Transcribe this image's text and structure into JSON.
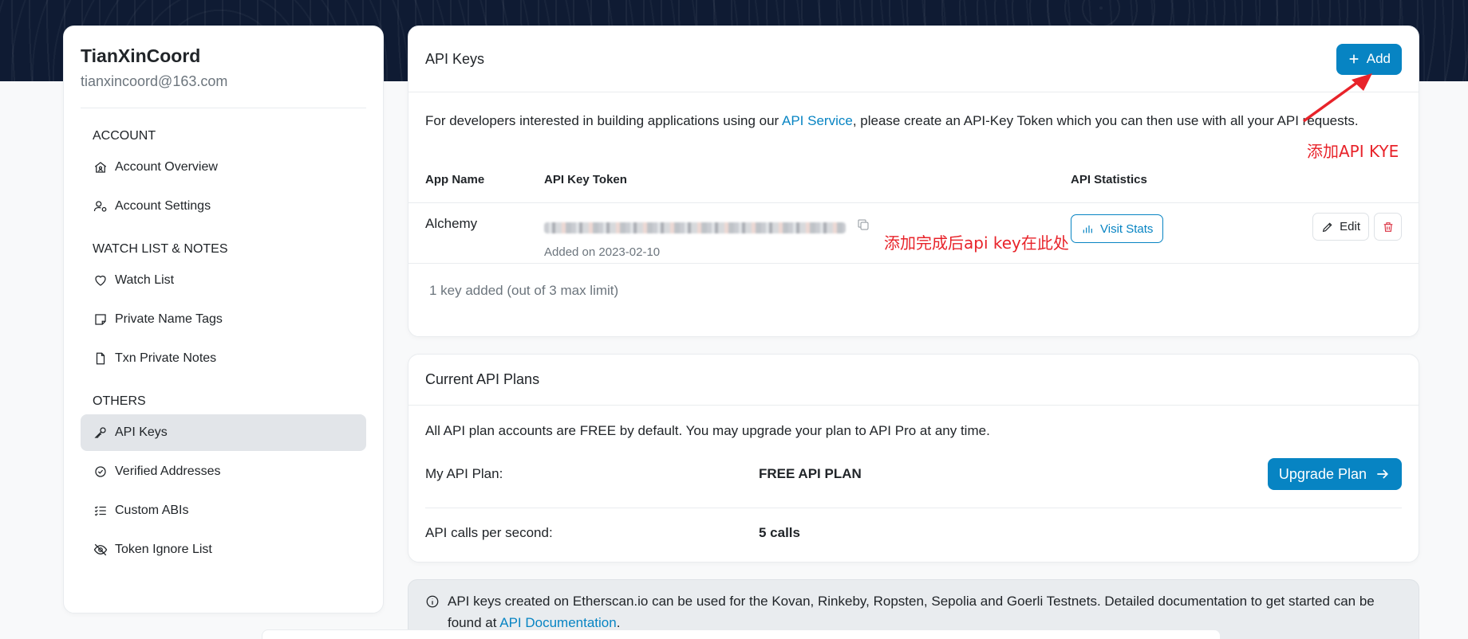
{
  "profile": {
    "name": "TianXinCoord",
    "email": "tianxincoord@163.com"
  },
  "sidebar": {
    "sections": [
      {
        "title": "ACCOUNT",
        "items": [
          {
            "label": "Account Overview",
            "icon": "home-user-icon"
          },
          {
            "label": "Account Settings",
            "icon": "user-gear-icon"
          }
        ]
      },
      {
        "title": "WATCH LIST & NOTES",
        "items": [
          {
            "label": "Watch List",
            "icon": "heart-icon"
          },
          {
            "label": "Private Name Tags",
            "icon": "sticky-note-icon"
          },
          {
            "label": "Txn Private Notes",
            "icon": "file-icon"
          }
        ]
      },
      {
        "title": "OTHERS",
        "items": [
          {
            "label": "API Keys",
            "icon": "key-icon",
            "active": true
          },
          {
            "label": "Verified Addresses",
            "icon": "check-circle-icon"
          },
          {
            "label": "Custom ABIs",
            "icon": "list-check-icon"
          },
          {
            "label": "Token Ignore List",
            "icon": "eye-slash-icon"
          }
        ]
      }
    ]
  },
  "api_keys": {
    "title": "API Keys",
    "add_label": "Add",
    "desc_prefix": "For developers interested in building applications using our ",
    "desc_link": "API Service",
    "desc_suffix": ", please create an API-Key Token which you can then use with all your API requests.",
    "columns": {
      "app": "App Name",
      "token": "API Key Token",
      "stats": "API Statistics"
    },
    "rows": [
      {
        "app": "Alchemy",
        "added": "Added on 2023-02-10",
        "stats_label": "Visit Stats",
        "edit_label": "Edit"
      }
    ],
    "limit_text": "1 key added (out of 3 max limit)"
  },
  "plans": {
    "title": "Current API Plans",
    "intro": "All API plan accounts are FREE by default. You may upgrade your plan to API Pro at any time.",
    "plan_label": "My API Plan:",
    "plan_value": "FREE API PLAN",
    "upgrade_label": "Upgrade Plan",
    "calls_label": "API calls per second:",
    "calls_value": "5 calls"
  },
  "info": {
    "text": "API keys created on Etherscan.io can be used for the Kovan, Rinkeby, Ropsten, Sepolia and Goerli Testnets. Detailed documentation to get started can be found at ",
    "link": "API Documentation",
    "end": "."
  },
  "annotations": {
    "add_note": "添加API KYE",
    "key_note": "添加完成后api key在此处",
    "color": "#e8232a"
  },
  "colors": {
    "brand": "#0784c3",
    "danger": "#dc3545",
    "header_bg": "#0f1b33"
  }
}
